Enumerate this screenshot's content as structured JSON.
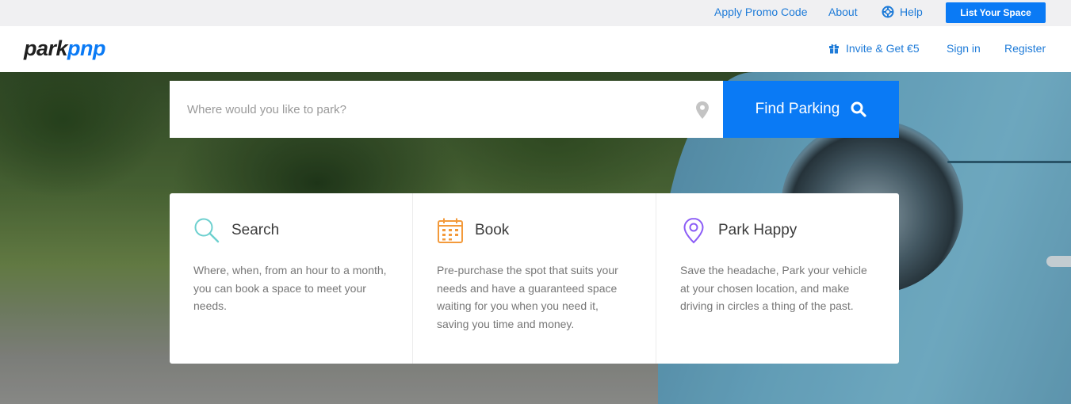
{
  "topbar": {
    "promo": "Apply Promo Code",
    "about": "About",
    "help": "Help",
    "list_space": "List Your Space"
  },
  "header": {
    "logo_park": "park",
    "logo_pnp": "pnp",
    "invite": "Invite & Get €5",
    "sign_in": "Sign in",
    "register": "Register"
  },
  "search": {
    "placeholder": "Where would you like to park?",
    "button": "Find Parking"
  },
  "features": [
    {
      "title": "Search",
      "icon": "magnifier-icon",
      "text": "Where, when, from an hour to a month, you can book a space to meet your needs."
    },
    {
      "title": "Book",
      "icon": "calendar-icon",
      "text": "Pre-purchase the spot that suits your needs and have a guaranteed space waiting for you when you need it, saving you time and money."
    },
    {
      "title": "Park Happy",
      "icon": "location-pin-icon",
      "text": "Save the headache, Park your vehicle at your chosen location, and make driving in circles a thing of the past."
    }
  ],
  "colors": {
    "brand": "#0a7af5",
    "link": "#1e7bd8",
    "search_icon": "#6dd0cf",
    "book_icon": "#f39a3b",
    "park_icon": "#8b5cf6"
  }
}
